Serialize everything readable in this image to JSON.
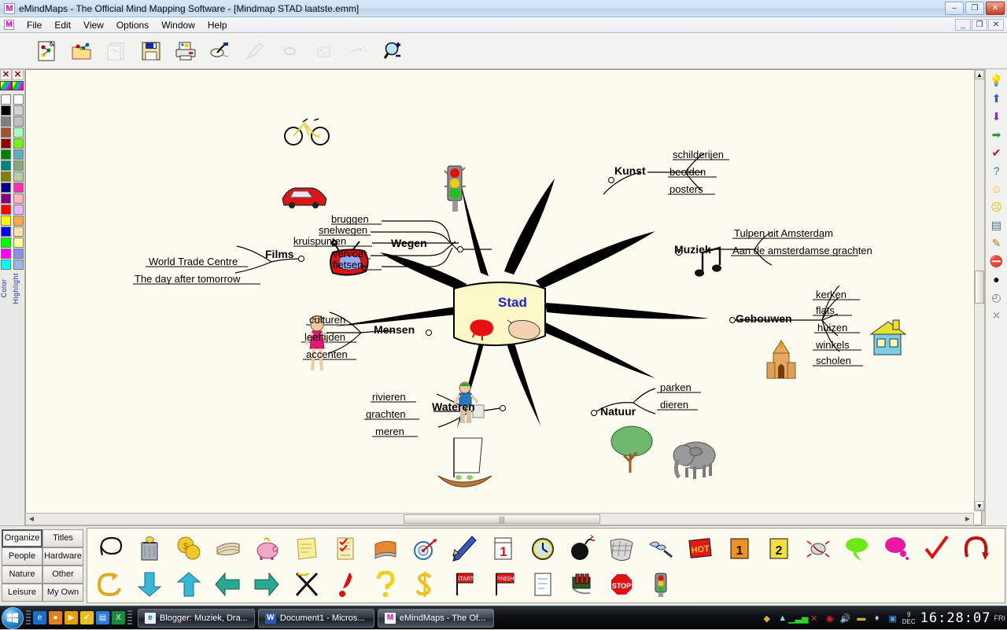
{
  "window": {
    "title": "eMindMaps - The Official  Mind Mapping Software - [Mindmap STAD laatste.emm]",
    "app_icon": "M",
    "minimize": "–",
    "maximize": "❐",
    "close": "✕",
    "doc_minimize": "_",
    "doc_restore": "❐",
    "doc_close": "✕"
  },
  "menu": {
    "icon": "M",
    "items": [
      {
        "label": "File"
      },
      {
        "label": "Edit"
      },
      {
        "label": "View"
      },
      {
        "label": "Options"
      },
      {
        "label": "Window"
      },
      {
        "label": "Help"
      }
    ]
  },
  "toolbar": {
    "buttons": [
      {
        "name": "new-map-button",
        "icon": "new-map-icon",
        "enabled": true
      },
      {
        "name": "open-map-button",
        "icon": "open-folder-icon",
        "enabled": true
      },
      {
        "name": "import-map-button",
        "icon": "import-map-icon",
        "enabled": false
      },
      {
        "name": "save-button",
        "icon": "floppy-disk-icon",
        "enabled": true
      },
      {
        "name": "print-button",
        "icon": "printer-icon",
        "enabled": true
      },
      {
        "name": "branch-tool-button",
        "icon": "branch-icon",
        "enabled": true
      },
      {
        "name": "rocket-button",
        "icon": "rocket-icon",
        "enabled": false
      },
      {
        "name": "link-button",
        "icon": "chain-link-icon",
        "enabled": false
      },
      {
        "name": "presentation-button",
        "icon": "presentation-icon",
        "enabled": false
      },
      {
        "name": "relation-button",
        "icon": "relation-arrow-icon",
        "enabled": false
      },
      {
        "name": "zoom-in-button",
        "icon": "magnifier-plus-icon",
        "enabled": true
      }
    ]
  },
  "palette": {
    "close_icon": "✕",
    "color_label": "Color",
    "highlight_label": "Highlight",
    "color_swatches": [
      "#ffffff",
      "#000000",
      "#808080",
      "#a0522d",
      "#8b0000",
      "#008000",
      "#008080",
      "#808000",
      "#000080",
      "#800080",
      "#ff0000",
      "#ffff00",
      "#0000ff",
      "#00ff00",
      "#ff00ff",
      "#00ffff"
    ],
    "highlight_swatches": [
      "#ffffff",
      "#d3d3d3",
      "#c0c0c0",
      "#aaffbb",
      "#77ee22",
      "#66aabb",
      "#88aa77",
      "#b8ccaa",
      "#ff33aa",
      "#ffb6c1",
      "#e6b8ff",
      "#ffa852",
      "#ffe0b0",
      "#ffffa0",
      "#8890e8",
      "#99b8e8"
    ]
  },
  "mindmap": {
    "center": {
      "label": "Stad",
      "color": "#2222cc",
      "bg": "#fbf8c8"
    },
    "branches": [
      {
        "name": "wegen",
        "label": "Wegen",
        "icons": [
          "bicycle-icon",
          "red-car-icon",
          "traffic-light-icon"
        ],
        "leaves": [
          "bruggen",
          "snelwegen",
          "kruispunten",
          "vervoer",
          "fietsen"
        ]
      },
      {
        "name": "kunst",
        "label": "Kunst",
        "icons": [],
        "leaves": [
          "schilderijen",
          "beelden",
          "posters"
        ]
      },
      {
        "name": "muziek",
        "label": "Muziek",
        "icons": [
          "music-notes-icon"
        ],
        "leaves": [
          "Tulpen uit Amsterdam",
          "Aan de amsterdamse grachten"
        ]
      },
      {
        "name": "gebouwen",
        "label": "Gebouwen",
        "icons": [
          "church-icon",
          "house-icon"
        ],
        "leaves": [
          "kerken",
          "flats",
          "huizen",
          "winkels",
          "scholen"
        ]
      },
      {
        "name": "natuur",
        "label": "Natuur",
        "icons": [
          "tree-icon",
          "elephant-icon"
        ],
        "leaves": [
          "parken",
          "dieren"
        ]
      },
      {
        "name": "wateren",
        "label": "Wateren",
        "icons": [
          "sailboat-icon"
        ],
        "leaves": [
          "rivieren",
          "grachten",
          "meren"
        ]
      },
      {
        "name": "mensen",
        "label": "Mensen",
        "icons": [
          "woman-icon",
          "boy-icon"
        ],
        "leaves": [
          "culturen",
          "leeftijden",
          "accenten"
        ]
      },
      {
        "name": "films",
        "label": "Films",
        "icons": [
          "television-icon"
        ],
        "leaves": [
          "World Trade Centre",
          "The day after tomorrow"
        ]
      }
    ]
  },
  "right_strip": {
    "icons": [
      {
        "name": "lightbulb-icon",
        "glyph": "💡"
      },
      {
        "name": "arrow-up-icon",
        "glyph": "⬆"
      },
      {
        "name": "arrow-down-icon",
        "glyph": "⬇"
      },
      {
        "name": "arrow-right-icon",
        "glyph": "➡"
      },
      {
        "name": "checkmark-icon",
        "glyph": "✔"
      },
      {
        "name": "question-mark-icon",
        "glyph": "?"
      },
      {
        "name": "smiley-happy-icon",
        "glyph": "☺"
      },
      {
        "name": "smiley-sad-icon",
        "glyph": "☹"
      },
      {
        "name": "note-icon",
        "glyph": "▤"
      },
      {
        "name": "pen-icon",
        "glyph": "✎"
      },
      {
        "name": "stop-sign-icon",
        "glyph": "⛔"
      },
      {
        "name": "bomb-icon",
        "glyph": "●"
      },
      {
        "name": "clock-icon",
        "glyph": "◴"
      },
      {
        "name": "cross-icon",
        "glyph": "✕"
      }
    ]
  },
  "clip_panel": {
    "categories": [
      {
        "label": "Organize",
        "selected": true
      },
      {
        "label": "Titles",
        "selected": false
      },
      {
        "label": "People",
        "selected": false
      },
      {
        "label": "Hardware",
        "selected": false
      },
      {
        "label": "Nature",
        "selected": false
      },
      {
        "label": "Other",
        "selected": false
      },
      {
        "label": "Leisure",
        "selected": false
      },
      {
        "label": "My Own",
        "selected": false
      }
    ],
    "row1": [
      {
        "name": "loop-arrow-icon"
      },
      {
        "name": "trash-can-icon"
      },
      {
        "name": "coins-icon"
      },
      {
        "name": "banknotes-icon"
      },
      {
        "name": "piggy-bank-icon"
      },
      {
        "name": "notes-icon"
      },
      {
        "name": "checklist-icon"
      },
      {
        "name": "book-icon"
      },
      {
        "name": "dartboard-icon"
      },
      {
        "name": "pencil-icon"
      },
      {
        "name": "calendar-icon"
      },
      {
        "name": "clock-icon"
      },
      {
        "name": "bomb-icon"
      },
      {
        "name": "net-icon"
      },
      {
        "name": "screws-icon"
      },
      {
        "name": "hot-sign-icon"
      },
      {
        "name": "priority-one-icon"
      },
      {
        "name": "priority-two-icon"
      },
      {
        "name": "bug-icon"
      },
      {
        "name": "green-bubble-icon"
      },
      {
        "name": "pink-bubble-icon"
      },
      {
        "name": "red-check-icon"
      },
      {
        "name": "undo-arrow-icon"
      }
    ],
    "row2": [
      {
        "name": "redo-arrow-icon"
      },
      {
        "name": "arrow-down-blue-icon"
      },
      {
        "name": "arrow-up-blue-icon"
      },
      {
        "name": "arrow-left-green-icon"
      },
      {
        "name": "arrow-right-green-icon"
      },
      {
        "name": "cross-out-icon"
      },
      {
        "name": "exclamation-icon"
      },
      {
        "name": "question-icon"
      },
      {
        "name": "dollar-icon"
      },
      {
        "name": "start-flag-icon"
      },
      {
        "name": "finish-flag-icon"
      },
      {
        "name": "document-icon"
      },
      {
        "name": "dynamite-icon"
      },
      {
        "name": "stop-sign-icon"
      },
      {
        "name": "traffic-light-icon"
      }
    ]
  },
  "taskbar": {
    "start_label": "Start",
    "quick_launch": [
      {
        "name": "internet-explorer-icon",
        "glyph": "e"
      },
      {
        "name": "firefox-icon",
        "glyph": "●"
      },
      {
        "name": "media-player-icon",
        "glyph": "▶"
      },
      {
        "name": "shield-icon",
        "glyph": "✔"
      },
      {
        "name": "window-icon",
        "glyph": "▤"
      },
      {
        "name": "excel-icon",
        "glyph": "X"
      }
    ],
    "tasks": [
      {
        "name": "task-blogger",
        "icon": "ie-icon",
        "glyph": "e",
        "label": "Blogger: Muziek, Dra..."
      },
      {
        "name": "task-word",
        "icon": "word-icon",
        "glyph": "W",
        "label": "Document1 - Micros..."
      },
      {
        "name": "task-emindmaps",
        "icon": "emindmaps-icon",
        "glyph": "M",
        "label": "eMindMaps - The Of..."
      }
    ],
    "tray_icons": [
      {
        "name": "security-shield-icon",
        "glyph": "◆"
      },
      {
        "name": "network-people-icon",
        "glyph": "▲"
      },
      {
        "name": "signal-bars-icon",
        "glyph": "▃"
      },
      {
        "name": "network-error-icon",
        "glyph": "✕"
      },
      {
        "name": "antivirus-icon",
        "glyph": "◉"
      },
      {
        "name": "volume-icon",
        "glyph": "🔊"
      },
      {
        "name": "battery-icon",
        "glyph": "▬"
      },
      {
        "name": "power-plug-icon",
        "glyph": "☨"
      },
      {
        "name": "monitor-icon",
        "glyph": "▣"
      }
    ],
    "clock": "16:28:07",
    "date_day": "9",
    "date_month": "DEC",
    "day_of_week": "FRI"
  }
}
